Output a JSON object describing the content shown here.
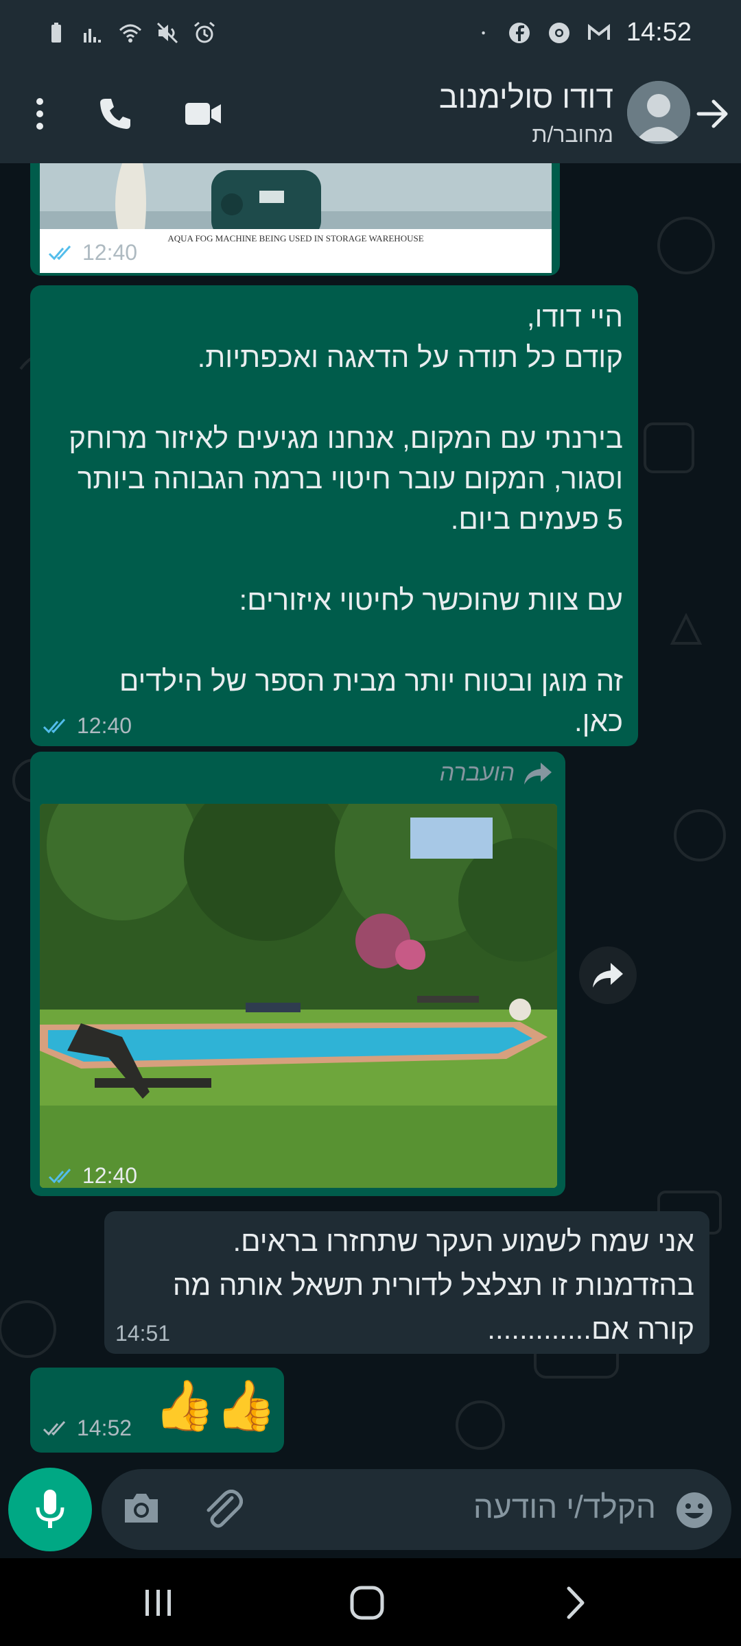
{
  "status_bar": {
    "time": "14:52",
    "icons_left": [
      "battery-icon",
      "signal-icon",
      "wifi-icon",
      "mute-icon",
      "alarm-icon"
    ],
    "icons_right": [
      "dot-icon",
      "facebook-icon",
      "chrome-icon",
      "gmail-icon"
    ]
  },
  "header": {
    "contact_name": "דודו סולימנוב",
    "status": "מחובר/ת"
  },
  "messages": {
    "m1": {
      "type": "image",
      "caption_in_image": "AQUA FOG MACHINE BEING USED IN STORAGE WAREHOUSE",
      "time": "12:40",
      "read": true
    },
    "m2": {
      "type": "text",
      "text": "היי דודו,\nקודם כל תודה על הדאגה ואכפתיות.\n\nבירנתי עם המקום, אנחנו מגיעים לאיזור מרוחק וסגור, המקום עובר חיטוי ברמה הגבוהה ביותר 5 פעמים ביום.\n\nעם צוות שהוכשר לחיטוי איזורים:\n\nזה מוגן ובטוח יותר מבית הספר של הילדים כאן.",
      "time": "12:40",
      "read": true
    },
    "m3": {
      "type": "image",
      "forwarded_label": "הועברה",
      "time": "12:40",
      "read": true
    },
    "m4": {
      "type": "text",
      "text": "אני שמח לשמוע העקר שתחזרו בראים.\nבהזדמנות זו תצלצל לדורית תשאל אותה מה קורה אם.............",
      "time": "14:51"
    },
    "m5": {
      "type": "emoji",
      "text": "👍👍",
      "time": "14:52",
      "read": false
    }
  },
  "composer": {
    "placeholder": "הקלד/י הודעה"
  },
  "colors": {
    "header_bg": "#1f2c34",
    "chat_bg": "#0b141a",
    "outgoing_bubble": "#005c4b",
    "incoming_bubble": "#1f2c34",
    "read_ticks": "#53bdeb",
    "accent": "#00a884"
  }
}
